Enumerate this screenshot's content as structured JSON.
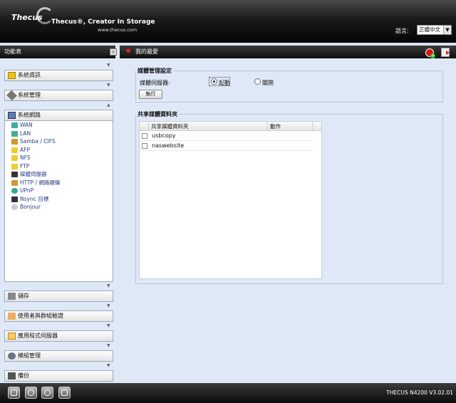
{
  "header": {
    "logo": "Thecus",
    "slogan": "Thecus®, Creator In Storage",
    "url": "www.thecus.com",
    "language_label": "語言:",
    "language_value": "正體中文"
  },
  "sidebar": {
    "title": "功能表",
    "sections": [
      {
        "label": "系統資訊"
      },
      {
        "label": "系統管理"
      },
      {
        "label": "系統網路"
      },
      {
        "label": "儲存"
      },
      {
        "label": "使用者與群組驗證"
      },
      {
        "label": "應用程式伺服器"
      },
      {
        "label": "模組管理"
      },
      {
        "label": "備份"
      }
    ],
    "network_items": [
      {
        "label": "WAN"
      },
      {
        "label": "LAN"
      },
      {
        "label": "Samba / CIFS"
      },
      {
        "label": "AFP"
      },
      {
        "label": "NFS"
      },
      {
        "label": "FTP"
      },
      {
        "label": "媒體伺服器"
      },
      {
        "label": "HTTP / 網路硬碟"
      },
      {
        "label": "UPnP"
      },
      {
        "label": "Nsync 目標"
      },
      {
        "label": "Bonjour"
      }
    ]
  },
  "main": {
    "title": "我的最愛",
    "media_settings": {
      "legend": "媒體管理設定",
      "server_label": "媒體伺服器:",
      "enable_label": "起動",
      "disable_label": "關閉",
      "selected": "enable",
      "apply_label": "執行"
    },
    "shared_folders": {
      "legend": "共享媒體資料夾",
      "col_folder": "共享媒體資料夾",
      "col_action": "動作",
      "rows": [
        {
          "name": "usbcopy",
          "checked": false
        },
        {
          "name": "naswebsite",
          "checked": false
        }
      ]
    }
  },
  "footer": {
    "version": "THECUS N4200 V3.02.01"
  },
  "colors": {
    "panel_bg": "#dfe8f6",
    "header_dark": "#0e0e0e",
    "link_blue": "#2a3d86"
  }
}
